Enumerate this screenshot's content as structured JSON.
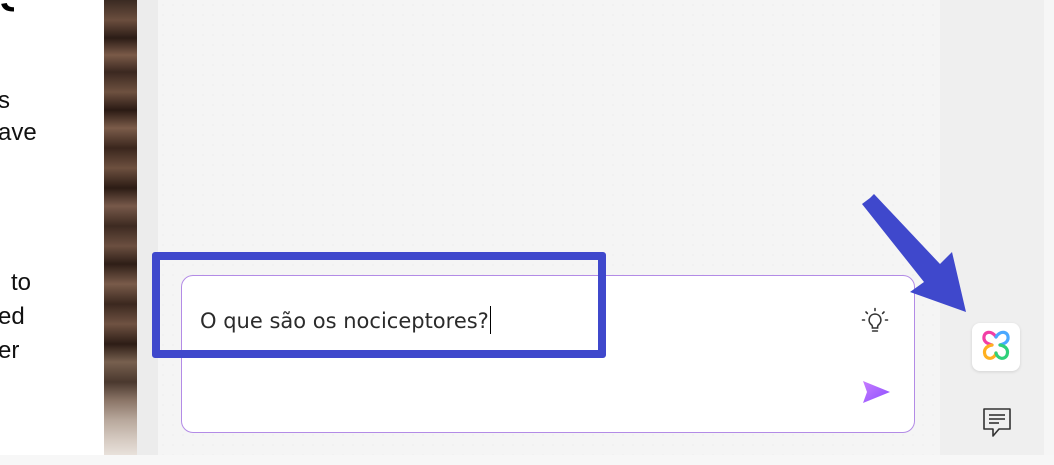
{
  "document": {
    "heading_fragment": "S",
    "lines": [
      "s",
      "ave",
      "to",
      "ed",
      "er"
    ]
  },
  "composer": {
    "value": "O que são os nociceptores?",
    "border_color": "#b38be6"
  },
  "icons": {
    "bulb": "lightbulb-icon",
    "send": "send-icon",
    "copilot": "copilot-icon",
    "feedback": "feedback-icon"
  },
  "colors": {
    "accent": "#a259ff",
    "highlight": "#3f48cc"
  }
}
